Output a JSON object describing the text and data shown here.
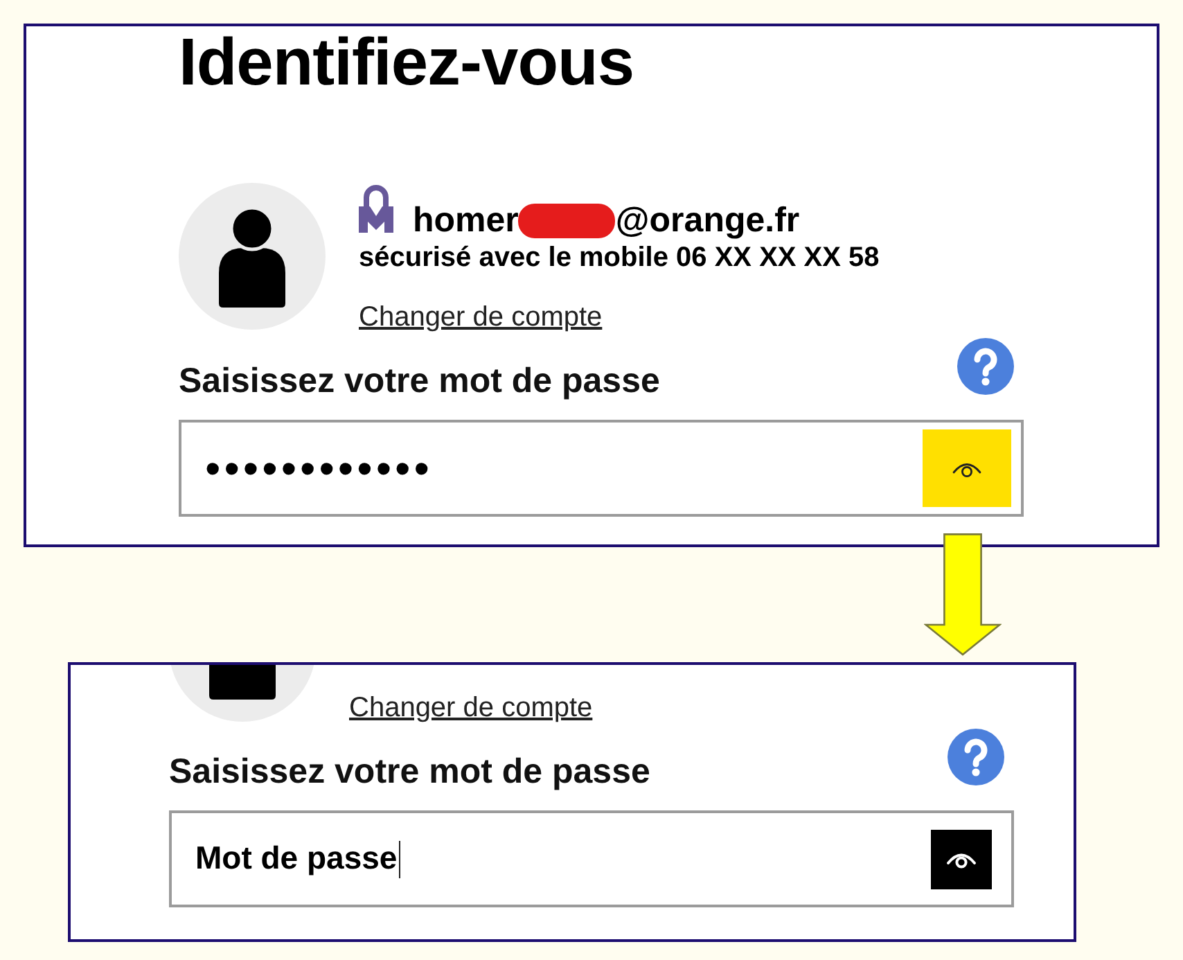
{
  "panels": [
    {
      "kind": "full",
      "title": "Identifiez-vous",
      "account": {
        "email_start": "homer",
        "redacted": true,
        "email_end": "@orange.fr",
        "security_note": "sécurisé avec le mobile 06 XX XX XX 58"
      },
      "change_account_link": "Changer de compte",
      "password_label": "Saisissez votre mot de passe",
      "password_field": {
        "kind": "masked",
        "value": "••••••••••••",
        "focused": false
      },
      "eye_button": {
        "highlighted": true
      }
    },
    {
      "kind": "cropped",
      "change_account_link": "Changer de compte",
      "password_label": "Saisissez votre mot de passe",
      "password_field": {
        "kind": "plain",
        "value": "Mot de passe",
        "focused": true
      },
      "eye_button": {
        "highlighted": false
      }
    }
  ]
}
